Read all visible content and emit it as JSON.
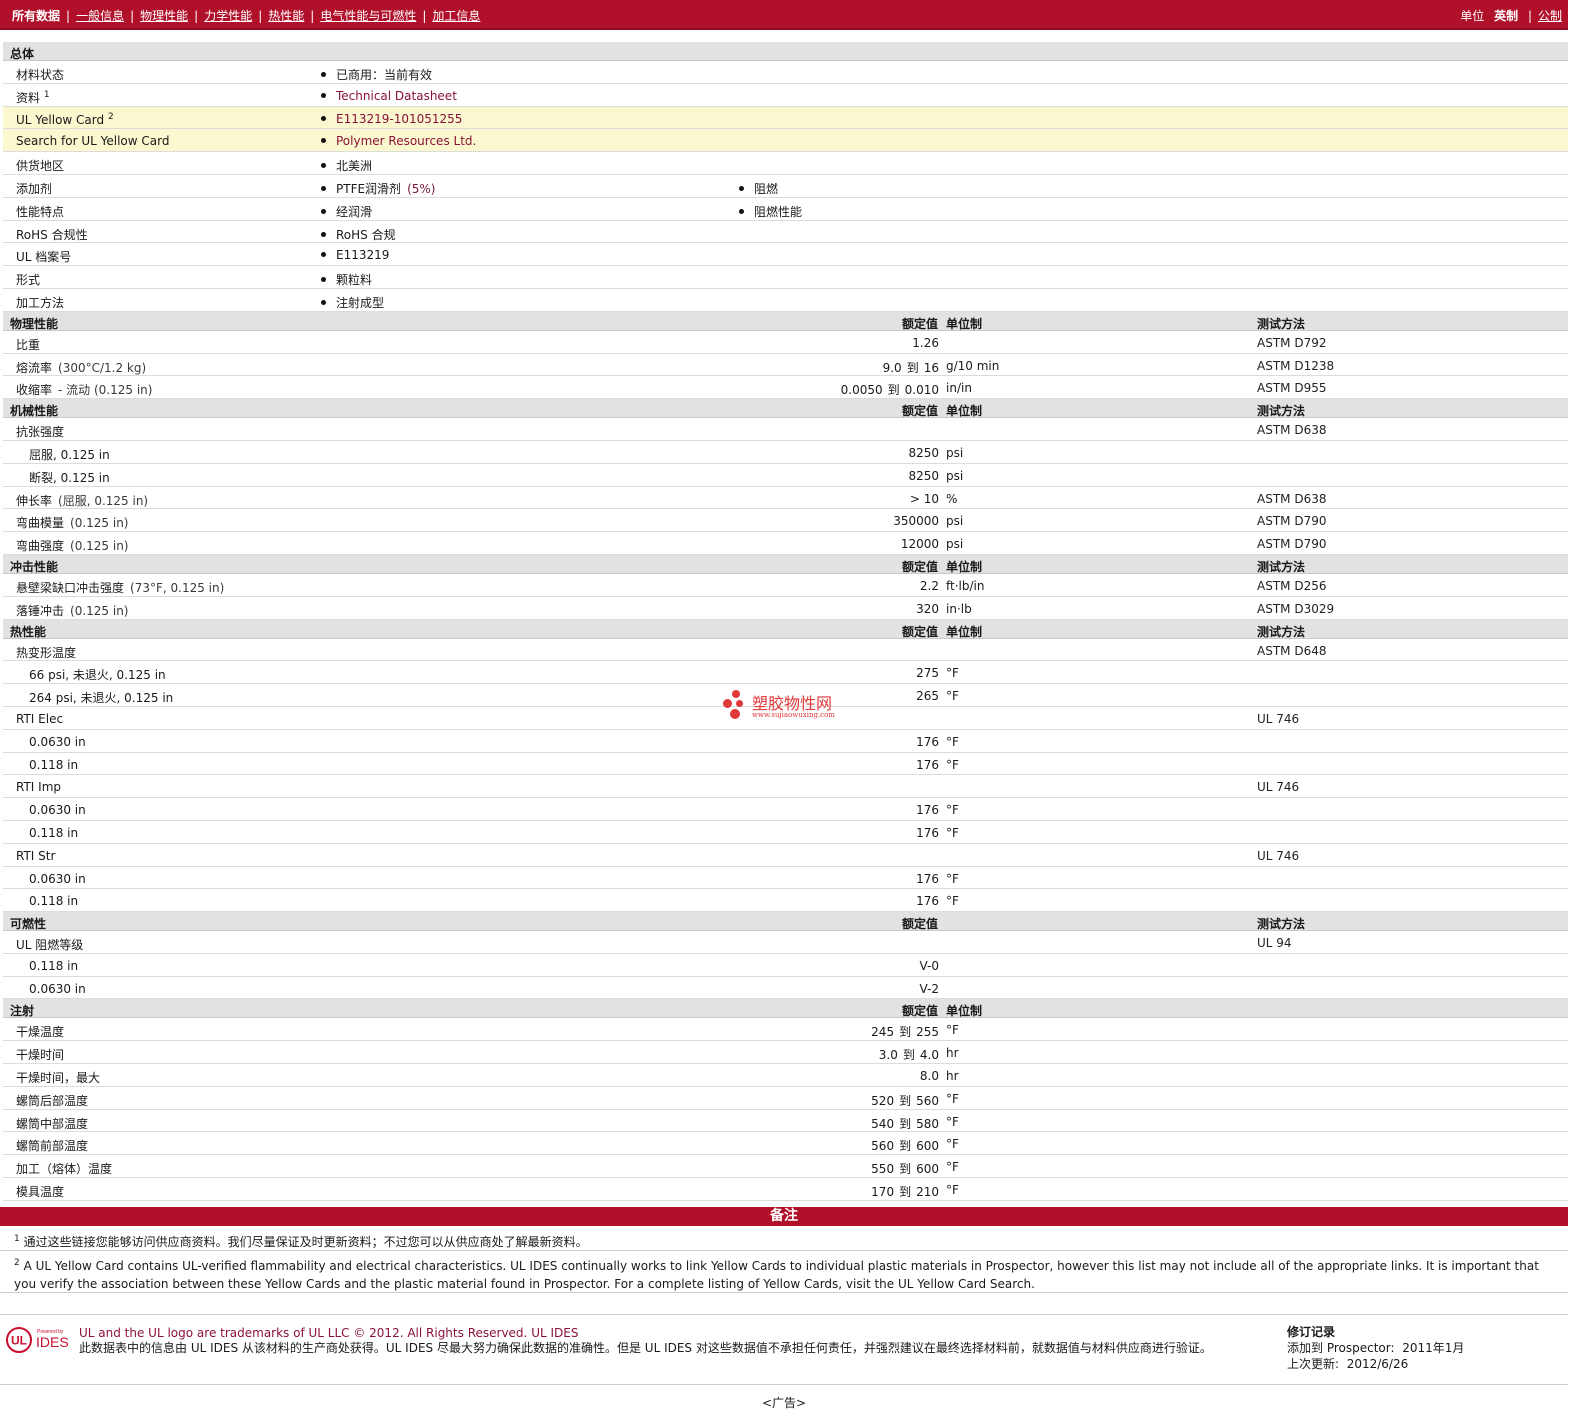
{
  "topnav": {
    "items": [
      "所有数据",
      "一般信息",
      "物理性能",
      "力学性能",
      "热性能",
      "电气性能与可燃性",
      "加工信息"
    ],
    "units_label": "单位",
    "units_active": "英制",
    "units_other": "公制"
  },
  "general": {
    "title": "总体",
    "rows": [
      {
        "label": "材料状态",
        "sup": "",
        "a": "已商用：当前有效",
        "b": "",
        "yellow": false,
        "link": false
      },
      {
        "label": "资料",
        "sup": "1",
        "a": "Technical Datasheet",
        "b": "",
        "yellow": false,
        "link": true
      },
      {
        "label": "UL Yellow Card",
        "sup": "2",
        "a": "E113219-101051255",
        "b": "",
        "yellow": true,
        "link": true
      },
      {
        "label": "Search for UL Yellow Card",
        "sup": "",
        "a": "Polymer Resources Ltd.",
        "b": "",
        "yellow": true,
        "link": true
      },
      {
        "label": "供货地区",
        "sup": "",
        "a": "北美洲",
        "b": "",
        "yellow": false,
        "link": false
      },
      {
        "label": "添加剂",
        "sup": "",
        "a": "PTFE润滑剂",
        "a_extra": "(5%)",
        "b": "阻燃",
        "yellow": false,
        "link": false
      },
      {
        "label": "性能特点",
        "sup": "",
        "a": "经润滑",
        "b": "阻燃性能",
        "yellow": false,
        "link": false
      },
      {
        "label": "RoHS 合规性",
        "sup": "",
        "a": "RoHS 合规",
        "b": "",
        "yellow": false,
        "link": false
      },
      {
        "label": "UL 档案号",
        "sup": "",
        "a": "E113219",
        "b": "",
        "yellow": false,
        "link": false
      },
      {
        "label": "形式",
        "sup": "",
        "a": "颗粒料",
        "b": "",
        "yellow": false,
        "link": false
      },
      {
        "label": "加工方法",
        "sup": "",
        "a": "注射成型",
        "b": "",
        "yellow": false,
        "link": false
      }
    ]
  },
  "sections": [
    {
      "title": "物理性能",
      "hval": "额定值",
      "hunit": "单位制",
      "hmethod": "测试方法",
      "rows": [
        {
          "label": "比重",
          "cond": "",
          "sub": false,
          "v1": "1.26",
          "v2": "",
          "unit": "",
          "method": "ASTM D792"
        },
        {
          "label": "熔流率",
          "cond": "(300°C/1.2 kg)",
          "sub": false,
          "v1": "9.0",
          "v2": "16",
          "unit": "g/10 min",
          "method": "ASTM D1238"
        },
        {
          "label": "收缩率",
          "cond": "- 流动   (0.125 in)",
          "sub": false,
          "v1": "0.0050",
          "v2": "0.010",
          "unit": "in/in",
          "method": "ASTM D955"
        }
      ]
    },
    {
      "title": "机械性能",
      "hval": "额定值",
      "hunit": "单位制",
      "hmethod": "测试方法",
      "rows": [
        {
          "label": "抗张强度",
          "cond": "",
          "sub": false,
          "v1": "",
          "v2": "",
          "unit": "",
          "method": "ASTM D638"
        },
        {
          "label": "屈服, 0.125 in",
          "cond": "",
          "sub": true,
          "v1": "8250",
          "v2": "",
          "unit": "psi",
          "method": ""
        },
        {
          "label": "断裂, 0.125 in",
          "cond": "",
          "sub": true,
          "v1": "8250",
          "v2": "",
          "unit": "psi",
          "method": ""
        },
        {
          "label": "伸长率",
          "cond": "(屈服, 0.125 in)",
          "sub": false,
          "v1": "> 10",
          "v2": "",
          "unit": "%",
          "method": "ASTM D638"
        },
        {
          "label": "弯曲模量",
          "cond": "(0.125 in)",
          "sub": false,
          "v1": "350000",
          "v2": "",
          "unit": "psi",
          "method": "ASTM D790"
        },
        {
          "label": "弯曲强度",
          "cond": "(0.125 in)",
          "sub": false,
          "v1": "12000",
          "v2": "",
          "unit": "psi",
          "method": "ASTM D790"
        }
      ]
    },
    {
      "title": "冲击性能",
      "hval": "额定值",
      "hunit": "单位制",
      "hmethod": "测试方法",
      "rows": [
        {
          "label": "悬壁梁缺口冲击强度",
          "cond": "(73°F, 0.125 in)",
          "sub": false,
          "v1": "2.2",
          "v2": "",
          "unit": "ft·lb/in",
          "method": "ASTM D256"
        },
        {
          "label": "落锤冲击",
          "cond": "(0.125 in)",
          "sub": false,
          "v1": "320",
          "v2": "",
          "unit": "in·lb",
          "method": "ASTM D3029"
        }
      ]
    },
    {
      "title": "热性能",
      "hval": "额定值",
      "hunit": "单位制",
      "hmethod": "测试方法",
      "rows": [
        {
          "label": "热变形温度",
          "cond": "",
          "sub": false,
          "v1": "",
          "v2": "",
          "unit": "",
          "method": "ASTM D648"
        },
        {
          "label": "66 psi, 未退火, 0.125 in",
          "cond": "",
          "sub": true,
          "v1": "275",
          "v2": "",
          "unit": "°F",
          "method": ""
        },
        {
          "label": "264 psi, 未退火, 0.125 in",
          "cond": "",
          "sub": true,
          "v1": "265",
          "v2": "",
          "unit": "°F",
          "method": ""
        },
        {
          "label": "RTI Elec",
          "cond": "",
          "sub": false,
          "v1": "",
          "v2": "",
          "unit": "",
          "method": "UL 746"
        },
        {
          "label": "0.0630 in",
          "cond": "",
          "sub": true,
          "v1": "176",
          "v2": "",
          "unit": "°F",
          "method": ""
        },
        {
          "label": "0.118 in",
          "cond": "",
          "sub": true,
          "v1": "176",
          "v2": "",
          "unit": "°F",
          "method": ""
        },
        {
          "label": "RTI Imp",
          "cond": "",
          "sub": false,
          "v1": "",
          "v2": "",
          "unit": "",
          "method": "UL 746"
        },
        {
          "label": "0.0630 in",
          "cond": "",
          "sub": true,
          "v1": "176",
          "v2": "",
          "unit": "°F",
          "method": ""
        },
        {
          "label": "0.118 in",
          "cond": "",
          "sub": true,
          "v1": "176",
          "v2": "",
          "unit": "°F",
          "method": ""
        },
        {
          "label": "RTI Str",
          "cond": "",
          "sub": false,
          "v1": "",
          "v2": "",
          "unit": "",
          "method": "UL 746"
        },
        {
          "label": "0.0630 in",
          "cond": "",
          "sub": true,
          "v1": "176",
          "v2": "",
          "unit": "°F",
          "method": ""
        },
        {
          "label": "0.118 in",
          "cond": "",
          "sub": true,
          "v1": "176",
          "v2": "",
          "unit": "°F",
          "method": ""
        }
      ]
    },
    {
      "title": "可燃性",
      "hval": "额定值",
      "hunit": "",
      "hmethod": "测试方法",
      "rows": [
        {
          "label": "UL 阻燃等级",
          "cond": "",
          "sub": false,
          "v1": "",
          "v2": "",
          "unit": "",
          "method": "UL 94"
        },
        {
          "label": "0.118 in",
          "cond": "",
          "sub": true,
          "v1": "V-0",
          "v2": "",
          "unit": "",
          "method": ""
        },
        {
          "label": "0.0630 in",
          "cond": "",
          "sub": true,
          "v1": "V-2",
          "v2": "",
          "unit": "",
          "method": ""
        }
      ]
    },
    {
      "title": "注射",
      "hval": "额定值",
      "hunit": "单位制",
      "hmethod": "",
      "rows": [
        {
          "label": "干燥温度",
          "cond": "",
          "sub": false,
          "v1": "245",
          "v2": "255",
          "unit": "°F",
          "method": ""
        },
        {
          "label": "干燥时间",
          "cond": "",
          "sub": false,
          "v1": "3.0",
          "v2": "4.0",
          "unit": "hr",
          "method": ""
        },
        {
          "label": "干燥时间，最大",
          "cond": "",
          "sub": false,
          "v1": "8.0",
          "v2": "",
          "unit": "hr",
          "method": ""
        },
        {
          "label": "螺筒后部温度",
          "cond": "",
          "sub": false,
          "v1": "520",
          "v2": "560",
          "unit": "°F",
          "method": ""
        },
        {
          "label": "螺筒中部温度",
          "cond": "",
          "sub": false,
          "v1": "540",
          "v2": "580",
          "unit": "°F",
          "method": ""
        },
        {
          "label": "螺筒前部温度",
          "cond": "",
          "sub": false,
          "v1": "560",
          "v2": "600",
          "unit": "°F",
          "method": ""
        },
        {
          "label": "加工（熔体）温度",
          "cond": "",
          "sub": false,
          "v1": "550",
          "v2": "600",
          "unit": "°F",
          "method": ""
        },
        {
          "label": "模具温度",
          "cond": "",
          "sub": false,
          "v1": "170",
          "v2": "210",
          "unit": "°F",
          "method": ""
        }
      ]
    }
  ],
  "range_word": "到",
  "notes": {
    "title": "备注",
    "n1_sup": "1",
    "n1": "通过这些链接您能够访问供应商资料。我们尽量保证及时更新资料；不过您可以从供应商处了解最新资料。",
    "n2_sup": "2",
    "n2": "A UL Yellow Card contains UL-verified flammability and electrical characteristics. UL IDES continually works to link Yellow Cards to individual plastic materials in Prospector, however this list may not include all of the appropriate links. It is important that you verify the association between these Yellow Cards and the plastic material found in Prospector. For a complete listing of Yellow Cards, visit the UL Yellow Card Search."
  },
  "footer": {
    "logo_ul": "UL",
    "logo_small": "Powered by",
    "logo_ides": "IDES",
    "line1": "UL and the UL logo are trademarks of UL LLC © 2012. All Rights Reserved.",
    "line1_link": "UL IDES",
    "line2": "此数据表中的信息由 UL IDES 从该材料的生产商处获得。UL IDES 尽最大努力确保此数据的准确性。但是 UL IDES 对这些数据值不承担任何责任，并强烈建议在最终选择材料前，就数据值与材料供应商进行验证。",
    "rev_title": "修订记录",
    "rev_added_label": "添加到",
    "rev_added_where": "Prospector:",
    "rev_added_date": "2011年1月",
    "rev_updated_label": "上次更新:",
    "rev_updated_date": "2012/6/26",
    "ad": "<广告>"
  },
  "watermark": {
    "cn": "塑胶物性网",
    "url": "www.sujiaowuxing.com"
  },
  "colors": {
    "brand": "#b0102a",
    "link": "#8a1238",
    "highlight": "#fbf7cf",
    "section": "#e2e2e2"
  }
}
